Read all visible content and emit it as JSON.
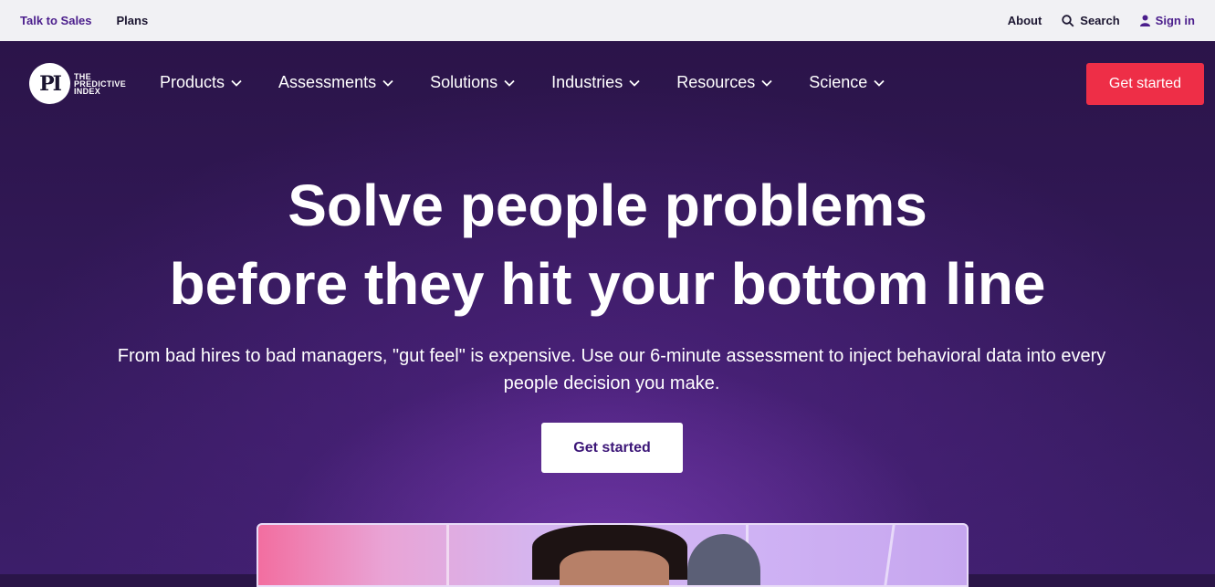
{
  "utility_bar": {
    "left_links": [
      "Talk to Sales",
      "Plans"
    ],
    "about": "About",
    "search": "Search",
    "sign_in": "Sign in"
  },
  "logo": {
    "mark": "PI",
    "lines": [
      "THE",
      "PREDICTIVE",
      "INDEX"
    ]
  },
  "nav": {
    "items": [
      "Products",
      "Assessments",
      "Solutions",
      "Industries",
      "Resources",
      "Science"
    ],
    "cta": "Get started"
  },
  "hero": {
    "headline_line1": "Solve people problems",
    "headline_line2": "before they hit your bottom line",
    "subtext": "From bad hires to bad managers, \"gut feel\" is expensive. Use our 6-minute assessment to inject behavioral data into every people decision you make.",
    "cta": "Get started"
  },
  "colors": {
    "accent_purple": "#4b1e8c",
    "cta_red": "#ee2e47",
    "hero_bg": "#2b1449"
  },
  "icons": [
    "search-icon",
    "user-icon",
    "chevron-down-icon"
  ]
}
